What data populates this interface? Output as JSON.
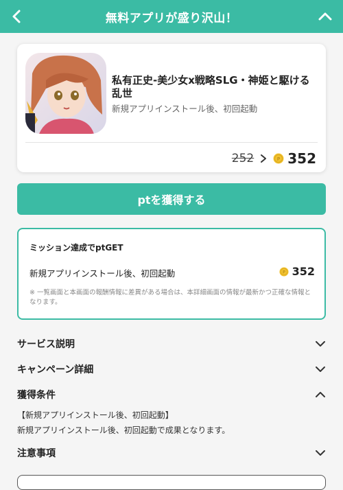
{
  "header": {
    "title": "無料アプリが盛り沢山！"
  },
  "app": {
    "title": "私有正史-美少女x戦略SLG・神姫と駆ける乱世",
    "subtitle": "新規アプリインストール後、初回起動",
    "old_points": "252",
    "new_points": "352"
  },
  "get_button": {
    "label": "ptを獲得する"
  },
  "mission": {
    "title": "ミッション達成でptGET",
    "item_label": "新規アプリインストール後、初回起動",
    "item_points": "352",
    "note": "※ 一覧画面と本画面の報酬情報に差異がある場合は、本詳細画面の情報が最新かつ正確な情報となります。"
  },
  "sections": {
    "service": "サービス説明",
    "campaign": "キャンペーン詳細",
    "conditions": "獲得条件",
    "conditions_line1": "【新規アプリインストール後、初回起動】",
    "conditions_line2": "新規アプリインストール後、初回起動で成果となります。",
    "notes": "注意事項"
  },
  "colors": {
    "accent": "#3bbba4",
    "coin": "#f2c230"
  },
  "icons": [
    "back-arrow-icon",
    "chevron-up-icon",
    "chevron-down-icon",
    "coin-icon",
    "arrow-right-icon"
  ]
}
